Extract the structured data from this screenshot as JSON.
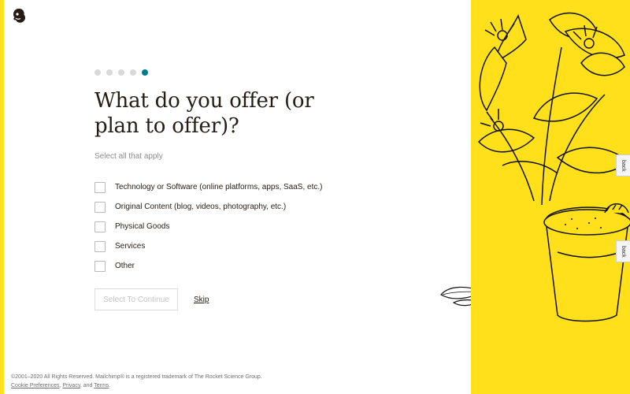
{
  "brand": {
    "logo_icon": "mailchimp-freddie-icon",
    "accent": "#ffe01b",
    "progress_color": "#007c89"
  },
  "progress": {
    "total_steps": 5,
    "current_step": 5
  },
  "question": {
    "title": "What do you offer (or plan to offer)?",
    "subtitle": "Select all that apply"
  },
  "options": [
    {
      "label": "Technology or Software (online platforms, apps, SaaS, etc.)",
      "checked": false
    },
    {
      "label": "Original Content (blog, videos, photography, etc.)",
      "checked": false
    },
    {
      "label": "Physical Goods",
      "checked": false
    },
    {
      "label": "Services",
      "checked": false
    },
    {
      "label": "Other",
      "checked": false
    }
  ],
  "actions": {
    "continue_label": "Select To Continue",
    "skip_label": "Skip"
  },
  "footer": {
    "copyright": "©2001–2020 All Rights Reserved. Mailchimp® is a registered trademark of The Rocket Science Group.",
    "cookie_label": "Cookie Preferences",
    "privacy_label": "Privacy",
    "and_text": ", and",
    "terms_label": "Terms"
  },
  "feedback_tabs": [
    {
      "label": "back"
    },
    {
      "label": "back"
    }
  ]
}
